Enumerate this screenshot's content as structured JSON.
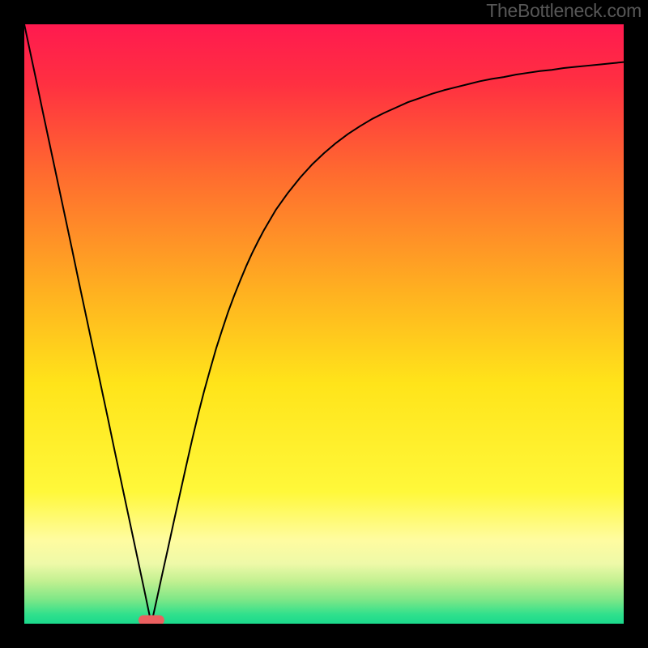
{
  "watermark": "TheBottleneck.com",
  "chart_data": {
    "type": "line",
    "title": "",
    "xlabel": "",
    "ylabel": "",
    "xlim": [
      0,
      1
    ],
    "ylim": [
      0,
      1
    ],
    "background_gradient": {
      "stops": [
        {
          "offset": 0.0,
          "color": "#ff1a4f"
        },
        {
          "offset": 0.1,
          "color": "#ff3041"
        },
        {
          "offset": 0.25,
          "color": "#ff6b2f"
        },
        {
          "offset": 0.45,
          "color": "#ffb220"
        },
        {
          "offset": 0.6,
          "color": "#ffe41a"
        },
        {
          "offset": 0.78,
          "color": "#fff83a"
        },
        {
          "offset": 0.86,
          "color": "#fffca0"
        },
        {
          "offset": 0.9,
          "color": "#eef9a8"
        },
        {
          "offset": 0.93,
          "color": "#c0f090"
        },
        {
          "offset": 0.96,
          "color": "#7de787"
        },
        {
          "offset": 0.985,
          "color": "#2fe08c"
        },
        {
          "offset": 1.0,
          "color": "#1bd98c"
        }
      ]
    },
    "minimum_marker": {
      "x": 0.212,
      "y": 0.006,
      "color": "#eb6060"
    },
    "series": [
      {
        "name": "curve",
        "color": "#000000",
        "x": [
          0.0,
          0.01,
          0.02,
          0.03,
          0.04,
          0.05,
          0.06,
          0.07,
          0.08,
          0.09,
          0.1,
          0.11,
          0.12,
          0.13,
          0.14,
          0.15,
          0.16,
          0.17,
          0.18,
          0.19,
          0.2,
          0.21,
          0.212,
          0.22,
          0.23,
          0.24,
          0.25,
          0.26,
          0.27,
          0.28,
          0.29,
          0.3,
          0.31,
          0.32,
          0.33,
          0.34,
          0.35,
          0.36,
          0.37,
          0.38,
          0.39,
          0.4,
          0.42,
          0.44,
          0.46,
          0.48,
          0.5,
          0.52,
          0.54,
          0.56,
          0.58,
          0.6,
          0.62,
          0.64,
          0.66,
          0.68,
          0.7,
          0.72,
          0.74,
          0.76,
          0.78,
          0.8,
          0.82,
          0.84,
          0.86,
          0.88,
          0.9,
          0.92,
          0.94,
          0.96,
          0.98,
          1.0
        ],
        "values": [
          1.0,
          0.953,
          0.906,
          0.858,
          0.811,
          0.764,
          0.717,
          0.67,
          0.623,
          0.575,
          0.528,
          0.481,
          0.434,
          0.387,
          0.34,
          0.292,
          0.245,
          0.198,
          0.151,
          0.104,
          0.057,
          0.009,
          0.0,
          0.036,
          0.082,
          0.127,
          0.173,
          0.218,
          0.263,
          0.307,
          0.349,
          0.388,
          0.424,
          0.459,
          0.49,
          0.52,
          0.547,
          0.572,
          0.596,
          0.618,
          0.638,
          0.657,
          0.691,
          0.719,
          0.744,
          0.766,
          0.785,
          0.802,
          0.817,
          0.83,
          0.842,
          0.852,
          0.861,
          0.87,
          0.877,
          0.884,
          0.89,
          0.895,
          0.9,
          0.905,
          0.909,
          0.912,
          0.916,
          0.919,
          0.922,
          0.924,
          0.927,
          0.929,
          0.931,
          0.933,
          0.935,
          0.937
        ]
      }
    ]
  }
}
